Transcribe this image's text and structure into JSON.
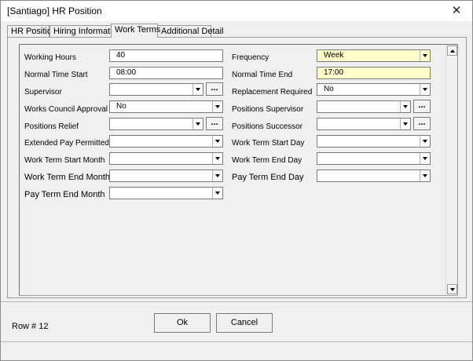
{
  "window": {
    "title": "[Santiago] HR Position",
    "close_glyph": "✕"
  },
  "tabs": [
    {
      "label": "HR Position"
    },
    {
      "label": "Hiring Information"
    },
    {
      "label": "Work Terms"
    },
    {
      "label": "Additional Detail"
    }
  ],
  "form": {
    "working_hours": {
      "label": "Working Hours",
      "value": "40"
    },
    "frequency": {
      "label": "Frequency",
      "value": "Week"
    },
    "normal_time_start": {
      "label": "Normal Time Start",
      "value": "08:00"
    },
    "normal_time_end": {
      "label": "Normal Time End",
      "value": "17:00"
    },
    "supervisor": {
      "label": "Supervisor",
      "value": ""
    },
    "replacement_required": {
      "label": "Replacement Required",
      "value": "No"
    },
    "works_council_approval": {
      "label": "Works Council Approval",
      "value": "No"
    },
    "positions_supervisor": {
      "label": "Positions Supervisor",
      "value": ""
    },
    "positions_relief": {
      "label": "Positions Relief",
      "value": ""
    },
    "positions_successor": {
      "label": "Positions Successor",
      "value": ""
    },
    "extended_pay_permitted": {
      "label": "Extended Pay Permitted",
      "value": ""
    },
    "work_term_start_day": {
      "label": "Work Term Start Day",
      "value": ""
    },
    "work_term_start_month": {
      "label": "Work Term Start Month",
      "value": ""
    },
    "work_term_end_day": {
      "label": "Work Term End Day",
      "value": ""
    },
    "work_term_end_month": {
      "label": "Work Term End Month",
      "value": ""
    },
    "pay_term_end_day": {
      "label": "Pay Term End Day",
      "value": ""
    },
    "pay_term_end_month": {
      "label": "Pay Term End Month",
      "value": ""
    },
    "ellipsis_label": "..."
  },
  "footer": {
    "row_number": "Row # 12",
    "ok_label": "Ok",
    "cancel_label": "Cancel"
  },
  "colors": {
    "highlight_field": "#ffffcc"
  },
  "icons": {
    "close": "close-icon",
    "dropdown": "chevron-down-icon",
    "scroll_up": "scroll-up-arrow-icon",
    "scroll_down": "scroll-down-arrow-icon"
  }
}
